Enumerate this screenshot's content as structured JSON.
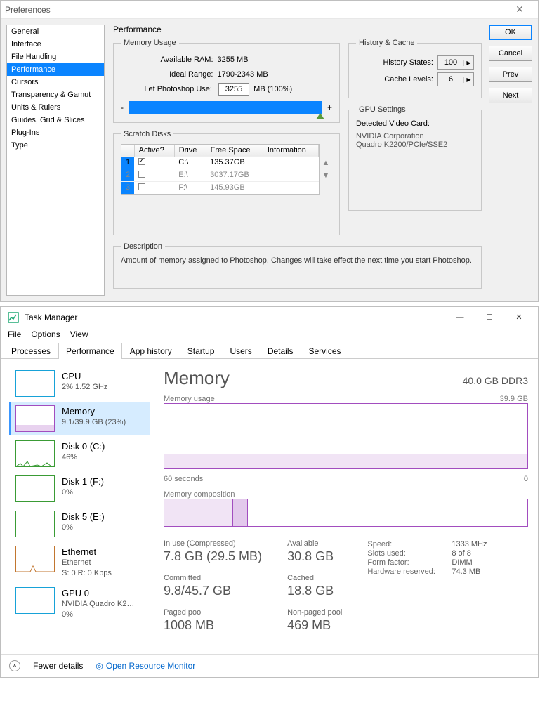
{
  "ps": {
    "window_title": "Preferences",
    "categories": [
      "General",
      "Interface",
      "File Handling",
      "Performance",
      "Cursors",
      "Transparency & Gamut",
      "Units & Rulers",
      "Guides, Grid & Slices",
      "Plug-Ins",
      "Type"
    ],
    "selected_index": 3,
    "main_title": "Performance",
    "buttons": {
      "ok": "OK",
      "cancel": "Cancel",
      "prev": "Prev",
      "next": "Next"
    },
    "memory_usage": {
      "legend": "Memory Usage",
      "available_label": "Available RAM:",
      "available_value": "3255 MB",
      "ideal_label": "Ideal Range:",
      "ideal_value": "1790-2343 MB",
      "use_label": "Let Photoshop Use:",
      "use_value": "3255",
      "use_suffix": "MB (100%)",
      "slider_minus": "-",
      "slider_plus": "+"
    },
    "history_cache": {
      "legend": "History & Cache",
      "history_label": "History States:",
      "history_value": "100",
      "cache_label": "Cache Levels:",
      "cache_value": "6"
    },
    "scratch_disks": {
      "legend": "Scratch Disks",
      "headers": {
        "active": "Active?",
        "drive": "Drive",
        "free": "Free Space",
        "info": "Information"
      },
      "rows": [
        {
          "idx": "1",
          "active": true,
          "drive": "C:\\",
          "free": "135.37GB",
          "info": ""
        },
        {
          "idx": "2",
          "active": false,
          "drive": "E:\\",
          "free": "3037.17GB",
          "info": ""
        },
        {
          "idx": "3",
          "active": false,
          "drive": "F:\\",
          "free": "145.93GB",
          "info": ""
        }
      ]
    },
    "gpu": {
      "legend": "GPU Settings",
      "detected_label": "Detected Video Card:",
      "vendor": "NVIDIA Corporation",
      "card": "Quadro K2200/PCIe/SSE2"
    },
    "description": {
      "legend": "Description",
      "text": "Amount of memory assigned to Photoshop. Changes will take effect the next time you start Photoshop."
    }
  },
  "tm": {
    "title": "Task Manager",
    "menu": [
      "File",
      "Options",
      "View"
    ],
    "tabs": [
      "Processes",
      "Performance",
      "App history",
      "Startup",
      "Users",
      "Details",
      "Services"
    ],
    "selected_tab": 1,
    "side": [
      {
        "name": "CPU",
        "sub": "2%  1.52 GHz",
        "kind": "cpu"
      },
      {
        "name": "Memory",
        "sub": "9.1/39.9 GB (23%)",
        "kind": "mem"
      },
      {
        "name": "Disk 0 (C:)",
        "sub": "46%",
        "kind": "disk"
      },
      {
        "name": "Disk 1 (F:)",
        "sub": "0%",
        "kind": "disk"
      },
      {
        "name": "Disk 5 (E:)",
        "sub": "0%",
        "kind": "disk"
      },
      {
        "name": "Ethernet",
        "sub": "Ethernet",
        "sub2": "S: 0  R: 0 Kbps",
        "kind": "eth"
      },
      {
        "name": "GPU 0",
        "sub": "NVIDIA Quadro K2…",
        "sub2": "0%",
        "kind": "gpu"
      }
    ],
    "side_selected": 1,
    "main": {
      "heading": "Memory",
      "heading_right": "40.0 GB DDR3",
      "graph": {
        "label_left": "Memory usage",
        "label_right": "39.9 GB",
        "axis_left": "60 seconds",
        "axis_right": "0"
      },
      "comp_label": "Memory composition",
      "stats": {
        "inuse_label": "In use (Compressed)",
        "inuse_value": "7.8 GB (29.5 MB)",
        "available_label": "Available",
        "available_value": "30.8 GB",
        "committed_label": "Committed",
        "committed_value": "9.8/45.7 GB",
        "cached_label": "Cached",
        "cached_value": "18.8 GB",
        "paged_label": "Paged pool",
        "paged_value": "1008 MB",
        "nonpaged_label": "Non-paged pool",
        "nonpaged_value": "469 MB"
      },
      "spec": {
        "speed_l": "Speed:",
        "speed_v": "1333 MHz",
        "slots_l": "Slots used:",
        "slots_v": "8 of 8",
        "form_l": "Form factor:",
        "form_v": "DIMM",
        "hw_l": "Hardware reserved:",
        "hw_v": "74.3 MB"
      }
    },
    "footer": {
      "fewer": "Fewer details",
      "orm": "Open Resource Monitor"
    }
  }
}
